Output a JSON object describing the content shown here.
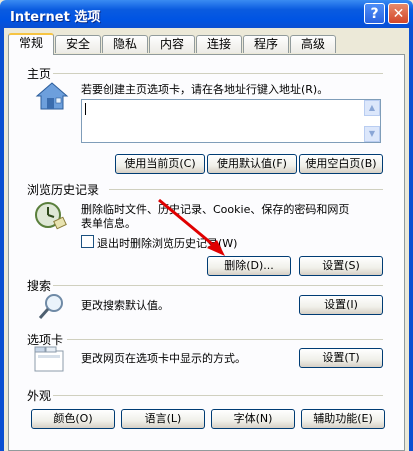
{
  "window": {
    "title": "Internet 选项",
    "help_label": "?",
    "close_label": "✕"
  },
  "tabs": [
    "常规",
    "安全",
    "隐私",
    "内容",
    "连接",
    "程序",
    "高级"
  ],
  "home": {
    "label": "主页",
    "desc": "若要创建主页选项卡，请在各地址行键入地址(R)。",
    "url_value": "",
    "buttons": [
      "使用当前页(C)",
      "使用默认值(F)",
      "使用空白页(B)"
    ]
  },
  "history": {
    "label": "浏览历史记录",
    "desc_line1": "删除临时文件、历史记录、Cookie、保存的密码和网页",
    "desc_line2": "表单信息。",
    "checkbox_label": "退出时删除浏览历史记录(W)",
    "delete_button": "删除(D)...",
    "settings_button": "设置(S)"
  },
  "search": {
    "label": "搜索",
    "desc": "更改搜索默认值。",
    "settings_button": "设置(I)"
  },
  "tabs_section": {
    "label": "选项卡",
    "desc": "更改网页在选项卡中显示的方式。",
    "settings_button": "设置(T)"
  },
  "appearance": {
    "label": "外观",
    "buttons": [
      "颜色(O)",
      "语言(L)",
      "字体(N)",
      "辅助功能(E)"
    ]
  },
  "icons": {
    "home": "home-icon",
    "history": "clock-eraser-icon",
    "search": "magnifier-icon",
    "tabs": "tabbed-window-icon"
  },
  "colors": {
    "titlebar": "#0054e3",
    "arrow": "#e00000"
  }
}
